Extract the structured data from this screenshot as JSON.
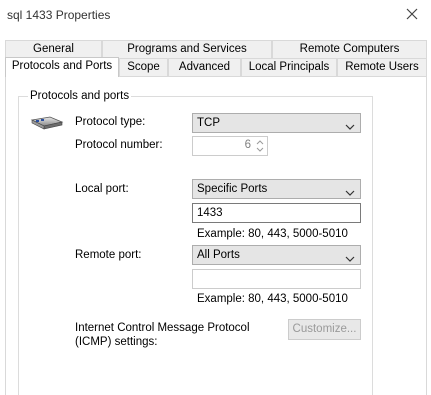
{
  "window": {
    "title": "sql 1433 Properties"
  },
  "tabs_back": [
    "General",
    "Programs and Services",
    "Remote Computers"
  ],
  "tabs_front": [
    "Protocols and Ports",
    "Scope",
    "Advanced",
    "Local Principals",
    "Remote Users"
  ],
  "group": {
    "title": "Protocols and ports"
  },
  "protocol_type": {
    "label": "Protocol type:",
    "value": "TCP"
  },
  "protocol_number": {
    "label": "Protocol number:",
    "value": "6"
  },
  "local_port": {
    "label": "Local port:",
    "value": "Specific Ports",
    "text": "1433",
    "example": "Example: 80, 443, 5000-5010"
  },
  "remote_port": {
    "label": "Remote port:",
    "value": "All Ports",
    "text": "",
    "example": "Example: 80, 443, 5000-5010"
  },
  "icmp": {
    "label_line1": "Internet Control Message Protocol",
    "label_line2": "(ICMP) settings:",
    "button": "Customize..."
  }
}
